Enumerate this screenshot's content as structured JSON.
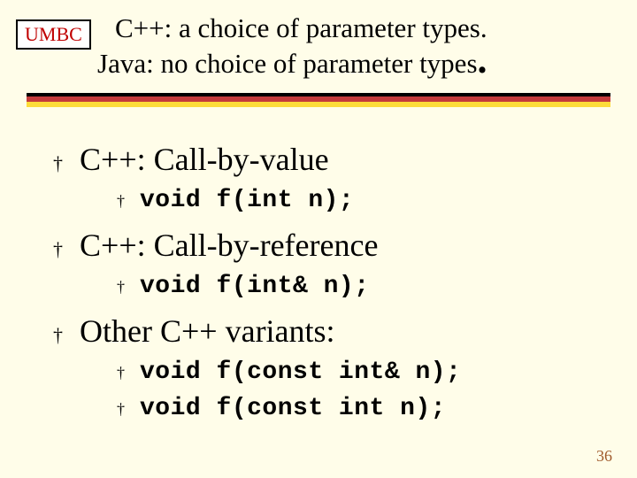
{
  "logo": {
    "text": "UMBC"
  },
  "title": {
    "line1": "C++: a choice of parameter types.",
    "line2": "Java: no choice of parameter types"
  },
  "bullets": [
    {
      "heading": "C++: Call-by-value",
      "subitems": [
        "void f(int n);"
      ]
    },
    {
      "heading": "C++: Call-by-reference",
      "subitems": [
        "void f(int& n);"
      ]
    },
    {
      "heading": "Other C++ variants:",
      "subitems": [
        "void f(const int& n);",
        "void f(const int n);"
      ]
    }
  ],
  "slide_number": "36"
}
